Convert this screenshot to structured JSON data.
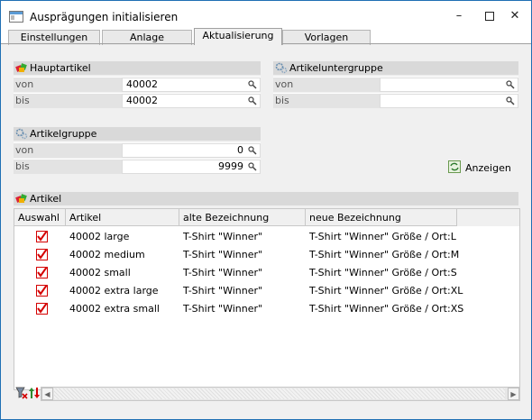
{
  "window": {
    "title": "Ausprägungen initialisieren",
    "minimize_icon": "minimize-icon",
    "maximize_icon": "maximize-icon",
    "close_icon": "close-icon"
  },
  "tabs": [
    {
      "label": "Einstellungen",
      "active": false
    },
    {
      "label": "Anlage",
      "active": false
    },
    {
      "label": "Aktualisierung",
      "active": true
    },
    {
      "label": "Vorlagen",
      "active": false
    }
  ],
  "hauptartikel": {
    "title": "Hauptartikel",
    "von_label": "von",
    "von_value": "40002",
    "bis_label": "bis",
    "bis_value": "40002"
  },
  "artikeluntergruppe": {
    "title": "Artikeluntergruppe",
    "von_label": "von",
    "von_value": "",
    "bis_label": "bis",
    "bis_value": ""
  },
  "artikelgruppe": {
    "title": "Artikelgruppe",
    "von_label": "von",
    "von_value": "0",
    "bis_label": "bis",
    "bis_value": "9999"
  },
  "anzeigen_button": "Anzeigen",
  "artikel": {
    "title": "Artikel",
    "columns": [
      "Auswahl",
      "Artikel",
      "alte Bezeichnung",
      "neue Bezeichnung"
    ],
    "rows": [
      {
        "checked": true,
        "artikel": "40002 large",
        "alte": "T-Shirt \"Winner\"",
        "neue": "T-Shirt \"Winner\" Größe / Ort:L"
      },
      {
        "checked": true,
        "artikel": "40002 medium",
        "alte": "T-Shirt \"Winner\"",
        "neue": "T-Shirt \"Winner\" Größe / Ort:M"
      },
      {
        "checked": true,
        "artikel": "40002 small",
        "alte": "T-Shirt \"Winner\"",
        "neue": "T-Shirt \"Winner\" Größe / Ort:S"
      },
      {
        "checked": true,
        "artikel": "40002 extra large",
        "alte": "T-Shirt \"Winner\"",
        "neue": "T-Shirt \"Winner\" Größe / Ort:XL"
      },
      {
        "checked": true,
        "artikel": "40002 extra small",
        "alte": "T-Shirt \"Winner\"",
        "neue": "T-Shirt \"Winner\" Größe / Ort:XS"
      }
    ]
  },
  "colors": {
    "window_border": "#1f6fb4",
    "header_bg": "#d9d9d9",
    "check_red": "#d40000"
  }
}
